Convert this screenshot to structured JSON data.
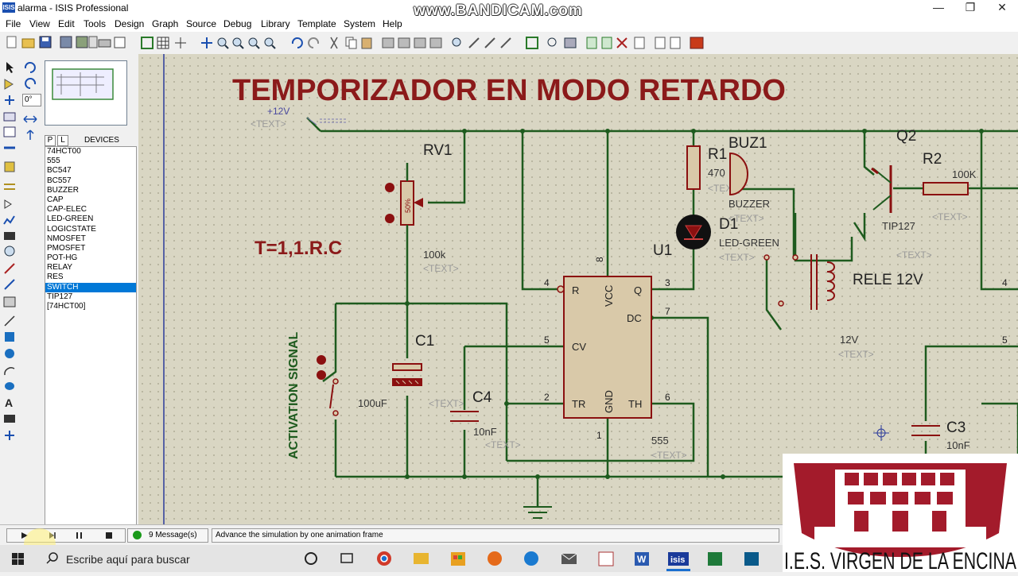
{
  "window": {
    "title": "alarma - ISIS Professional",
    "app_icon_text": "ISIS",
    "recorder_watermark": "www.BANDICAM.com"
  },
  "menu": [
    "File",
    "View",
    "Edit",
    "Tools",
    "Design",
    "Graph",
    "Source",
    "Debug",
    "Library",
    "Template",
    "System",
    "Help"
  ],
  "rotation_field": "0°",
  "device_panel": {
    "tab_p": "P",
    "tab_l": "L",
    "header": "DEVICES",
    "items": [
      "74HCT00",
      "555",
      "BC547",
      "BC557",
      "BUZZER",
      "CAP",
      "CAP-ELEC",
      "LED-GREEN",
      "LOGICSTATE",
      "NMOSFET",
      "PMOSFET",
      "POT-HG",
      "RELAY",
      "RES",
      "SWITCH",
      "TIP127",
      "[74HCT00]"
    ],
    "selected": "SWITCH"
  },
  "schematic": {
    "title": "TEMPORIZADOR EN MODO RETARDO",
    "formula": "T=1,1.R.C",
    "activation_label": "ACTIVATION SIGNAL",
    "power_label": "+12V",
    "text_placeholder": "<TEXT>",
    "rv1": {
      "ref": "RV1",
      "value": "100k",
      "wiper": "50%"
    },
    "r1": {
      "ref": "R1",
      "value": "470"
    },
    "buz1": {
      "ref": "BUZ1",
      "value": "BUZZER"
    },
    "d1": {
      "ref": "D1",
      "value": "LED-GREEN"
    },
    "u1": {
      "ref": "U1",
      "value": "555",
      "pins": {
        "r": "R",
        "vcc": "VCC",
        "q": "Q",
        "dc": "DC",
        "cv": "CV",
        "tr": "TR",
        "gnd": "GND",
        "th": "TH"
      },
      "pin_numbers": {
        "p4": "4",
        "p8": "8",
        "p3": "3",
        "p7": "7",
        "p5": "5",
        "p2": "2",
        "p6": "6",
        "p1": "1"
      }
    },
    "q2": {
      "ref": "Q2",
      "value": "TIP127"
    },
    "r2": {
      "ref": "R2",
      "value": "100K"
    },
    "relay": {
      "label": "RELE 12V",
      "value": "12V"
    },
    "c1": {
      "ref": "C1",
      "value": "100uF"
    },
    "c4": {
      "ref": "C4",
      "value": "10nF"
    },
    "c3": {
      "ref": "C3",
      "value": "10nF"
    },
    "right_pins": {
      "a": "4",
      "b": "5"
    }
  },
  "status": {
    "messages": "9 Message(s)",
    "hint": "Advance the simulation by one animation frame"
  },
  "taskbar": {
    "search_placeholder": "Escribe aquí para buscar"
  },
  "logo": {
    "text": "I.E.S. VIRGEN DE LA ENCINA"
  },
  "colors": {
    "wire": "#1e5b1e",
    "component": "#8b1010",
    "title": "#8b1a1a",
    "canvas": "#d9d6c3",
    "selection": "#0078d7"
  }
}
